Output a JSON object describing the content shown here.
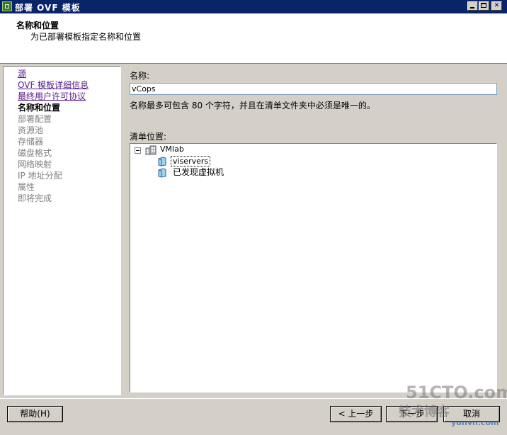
{
  "window": {
    "title": "部署 OVF 模板"
  },
  "header": {
    "title": "名称和位置",
    "subtitle": "为已部署模板指定名称和位置"
  },
  "steps": [
    {
      "label": "源",
      "state": "link"
    },
    {
      "label": "OVF 模板详细信息",
      "state": "link"
    },
    {
      "label": "最终用户许可协议",
      "state": "link"
    },
    {
      "label": "名称和位置",
      "state": "current"
    },
    {
      "label": "部署配置",
      "state": "future"
    },
    {
      "label": "资源池",
      "state": "future"
    },
    {
      "label": "存储器",
      "state": "future"
    },
    {
      "label": "磁盘格式",
      "state": "future"
    },
    {
      "label": "网络映射",
      "state": "future"
    },
    {
      "label": "IP 地址分配",
      "state": "future"
    },
    {
      "label": "属性",
      "state": "future"
    },
    {
      "label": "即将完成",
      "state": "future"
    }
  ],
  "form": {
    "name_label": "名称:",
    "name_value": "vCops",
    "name_hint": "名称最多可包含 80 个字符，并且在清单文件夹中必须是唯一的。",
    "inventory_label": "清单位置:"
  },
  "tree": {
    "root": {
      "label": "VMlab",
      "icon": "datacenter-icon",
      "expanded": true
    },
    "children": [
      {
        "label": "viservers",
        "icon": "folder-icon",
        "selected": true
      },
      {
        "label": "已发现虚拟机",
        "icon": "folder-icon",
        "selected": false
      }
    ]
  },
  "buttons": {
    "help": "帮助(H)",
    "back": "< 上一步",
    "next": "下一步",
    "cancel": "取消"
  },
  "watermark": {
    "line1": "51CTO.com",
    "line2": "技术博客",
    "line3": "yunvn.com"
  },
  "colors": {
    "titlebar": "#0a246a",
    "link": "#551a8b",
    "disabled": "#808080"
  }
}
